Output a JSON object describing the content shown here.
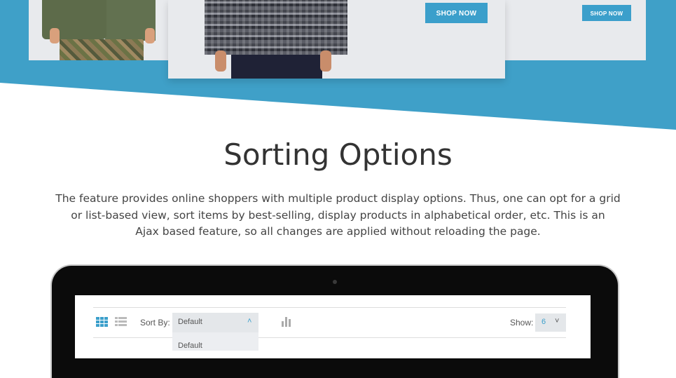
{
  "banner": {
    "shop_now_main": "SHOP NOW",
    "shop_now_side": "SHOP NOW"
  },
  "section": {
    "title": "Sorting Options",
    "description_lines": [
      "The feature provides online shoppers with multiple product display options. Thus, one can opt for a grid",
      "or list-based view, sort items by best-selling, display products in alphabetical order, etc. This is an",
      "Ajax based feature, so all changes are applied without reloading the page."
    ]
  },
  "toolbar": {
    "sort_label": "Sort By:",
    "sort_value": "Default",
    "sort_options": [
      "Default"
    ],
    "show_label": "Show:",
    "show_value": "6",
    "icons": [
      "grid-view-icon",
      "list-view-icon",
      "bar-chart-icon",
      "chevron-up-icon",
      "chevron-down-icon"
    ]
  },
  "colors": {
    "accent": "#3b9fcb",
    "band": "#3fa0c8",
    "heading": "#333333"
  }
}
